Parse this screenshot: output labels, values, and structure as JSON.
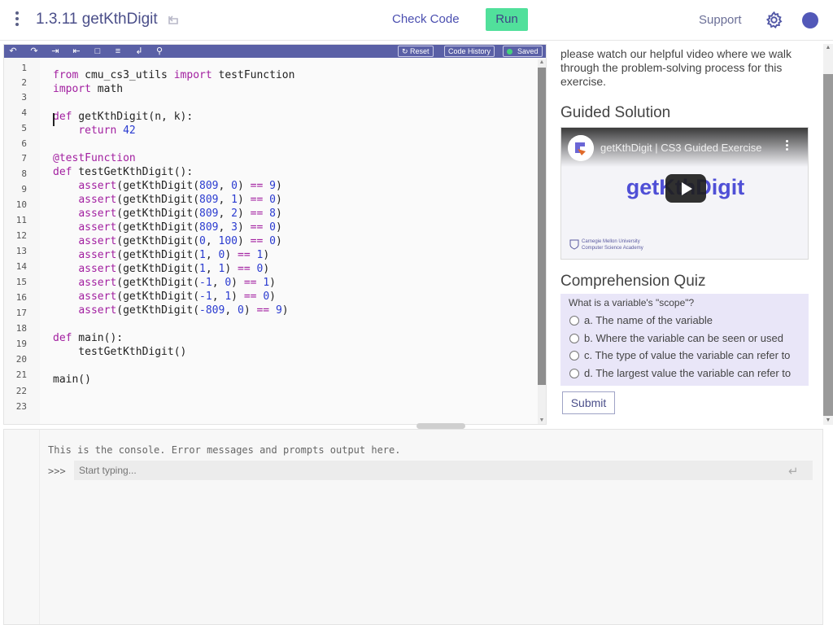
{
  "header": {
    "title": "1.3.11 getKthDigit",
    "check_code": "Check Code",
    "run": "Run",
    "support": "Support"
  },
  "editor_toolbar": {
    "reset": "Reset",
    "code_history": "Code History",
    "saved": "Saved"
  },
  "editor": {
    "line_numbers": [
      "1",
      "2",
      "3",
      "4",
      "5",
      "6",
      "7",
      "8",
      "9",
      "10",
      "11",
      "12",
      "13",
      "14",
      "15",
      "16",
      "17",
      "18",
      "19",
      "20",
      "21",
      "22",
      "23"
    ],
    "lines": [
      "from cmu_cs3_utils import testFunction",
      "import math",
      "",
      "def getKthDigit(n, k):",
      "    return 42",
      "",
      "@testFunction",
      "def testGetKthDigit():",
      "    assert(getKthDigit(809, 0) == 9)",
      "    assert(getKthDigit(809, 1) == 0)",
      "    assert(getKthDigit(809, 2) == 8)",
      "    assert(getKthDigit(809, 3) == 0)",
      "    assert(getKthDigit(0, 100) == 0)",
      "    assert(getKthDigit(1, 0) == 1)",
      "    assert(getKthDigit(1, 1) == 0)",
      "    assert(getKthDigit(-1, 0) == 1)",
      "    assert(getKthDigit(-1, 1) == 0)",
      "    assert(getKthDigit(-809, 0) == 9)",
      "",
      "def main():",
      "    testGetKthDigit()",
      "",
      "main()"
    ]
  },
  "console": {
    "message": "This is the console. Error messages and prompts output here.",
    "prompt": ">>>",
    "placeholder": "Start typing..."
  },
  "right_panel": {
    "intro": "please watch our helpful video where we walk through the problem-solving process for this exercise.",
    "guided_heading": "Guided Solution",
    "video_title": "getKthDigit | CS3 Guided Exercise",
    "video_big_text": "getKthDigit",
    "cmu_line1": "Carnegie Mellon University",
    "cmu_line2": "Computer Science Academy",
    "quiz_heading": "Comprehension Quiz",
    "quiz_question": "What is a variable's \"scope\"?",
    "options": [
      "a. The name of the variable",
      "b. Where the variable can be seen or used",
      "c. The type of value the variable can refer to",
      "d. The largest value the variable can refer to"
    ],
    "submit": "Submit"
  }
}
